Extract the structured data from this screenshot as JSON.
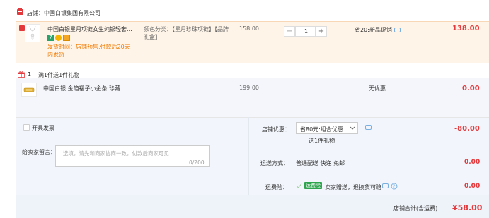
{
  "shop": {
    "label": "店铺：",
    "name": "中国白银集团有限公司"
  },
  "item": {
    "title": "中国白银星月项链女生纯银轻奢...",
    "spec": "颜色分类：【星月珍珠项链】【品牌礼盒】",
    "shipping_note": "发货时间：店铺预售,付款后20天内发货",
    "price": "158.00",
    "quantity": "1",
    "discount": "省20:新品促销",
    "subtotal": "138.00",
    "minus_label": "−",
    "plus_label": "+"
  },
  "gift": {
    "count": "1",
    "promo": "满1件送1件礼物",
    "title": "中国白银 金箔褶子小金条 珍藏...",
    "price": "199.00",
    "discount": "无优惠",
    "subtotal": "0.00"
  },
  "invoice": {
    "label": "开具发票"
  },
  "message": {
    "label": "给卖家留言：",
    "placeholder": "选填，请先和商家协商一致，付款后商家可见",
    "counter": "0/200"
  },
  "shop_coupon": {
    "label": "店铺优惠：",
    "selected": "省80元:组合优惠",
    "note": "送1件礼物",
    "amount": "-80.00"
  },
  "delivery": {
    "label": "运送方式：",
    "value": "普通配送 快递 免邮",
    "amount": "0.00"
  },
  "insurance": {
    "label": "运费险：",
    "tag": "运费险",
    "value": "卖家赠送，退换货可赔",
    "amount": "0.00"
  },
  "total": {
    "label": "店铺合计(含运费)",
    "amount": "¥58.00"
  },
  "colors": {
    "accent_red": "#e4393c",
    "orange_text": "#f07a00",
    "insurance_green": "#2ea44f"
  }
}
